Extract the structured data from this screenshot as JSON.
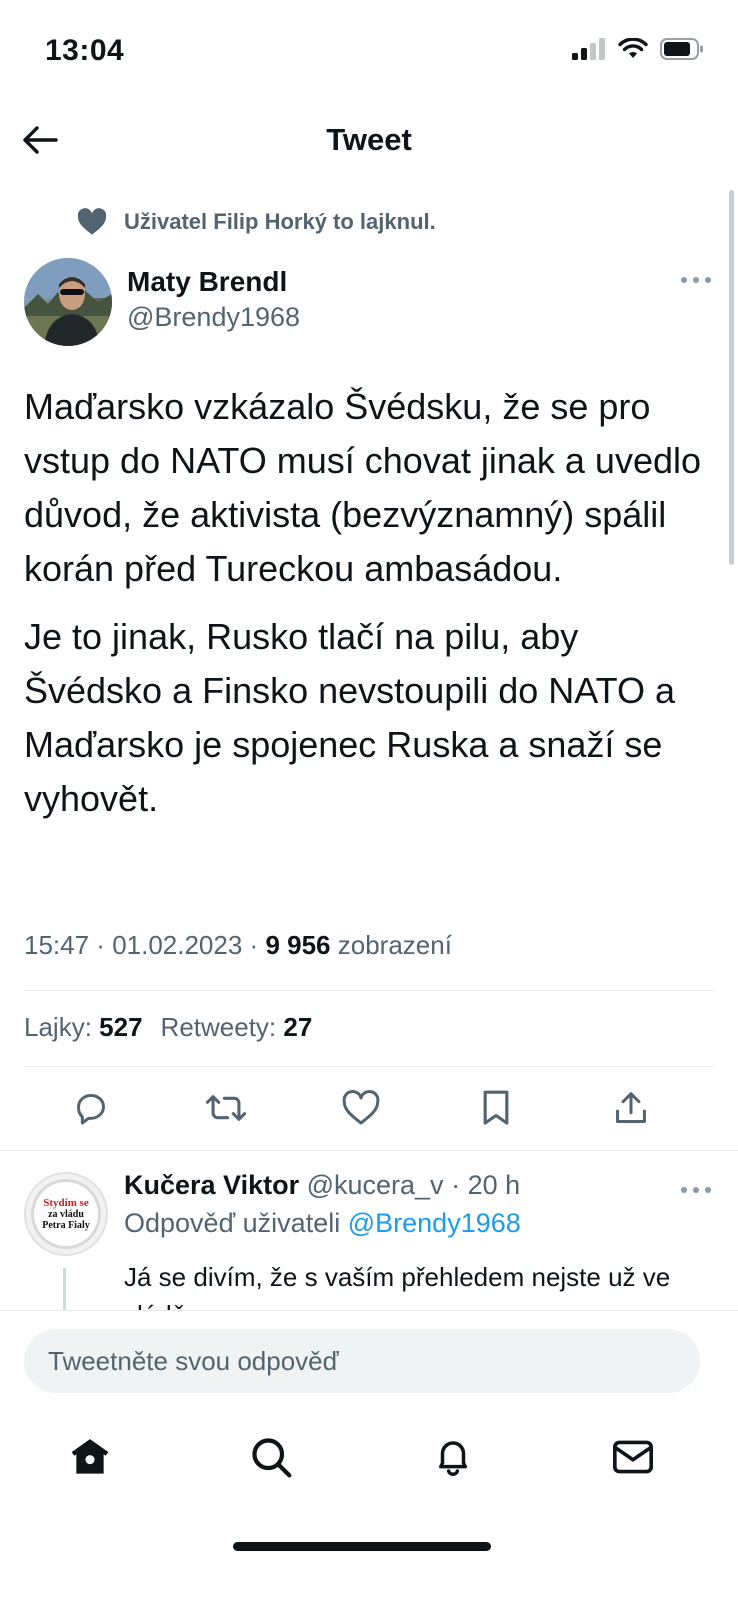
{
  "status_bar": {
    "time": "13:04"
  },
  "nav": {
    "title": "Tweet"
  },
  "social_context": {
    "text": "Uživatel Filip Horký to lajknul."
  },
  "tweet": {
    "author_name": "Maty Brendl",
    "author_handle": "@Brendy1968",
    "paragraphs": [
      "Maďarsko vzkázalo Švédsku, že se pro vstup do NATO musí chovat jinak a uvedlo důvod, že aktivista (bezvýznamný) spálil korán před Tureckou ambasádou.",
      "Je to jinak, Rusko tlačí na pilu, aby Švédsko a Finsko nevstoupili do NATO a Maďarsko je spojenec Ruska a snaží se vyhovět."
    ],
    "time": "15:47",
    "date": "01.02.2023",
    "views_count": "9 956",
    "views_label": "zobrazení",
    "likes_label": "Lajky:",
    "likes_count": "527",
    "retweets_label": "Retweety:",
    "retweets_count": "27"
  },
  "actions": [
    "reply-icon",
    "retweet-icon",
    "like-icon",
    "bookmark-icon",
    "share-icon"
  ],
  "reply": {
    "name": "Kučera Viktor",
    "handle": "@kucera_v",
    "time": "20 h",
    "replying_label": "Odpověď uživateli",
    "replying_handle": "@Brendy1968",
    "text": "Já se divím, že s vaším přehledem nejste už ve vládě",
    "avatar_badge": [
      "Stydím se",
      "za vládu",
      "Petra Fialy"
    ]
  },
  "composer": {
    "placeholder": "Tweetněte svou odpověď"
  },
  "tabbar": [
    "home-icon",
    "search-icon",
    "notifications-icon",
    "messages-icon"
  ],
  "colors": {
    "text": "#0f1419",
    "secondary": "#536471",
    "link": "#1d9bf0",
    "divider": "#e6e9eb"
  }
}
